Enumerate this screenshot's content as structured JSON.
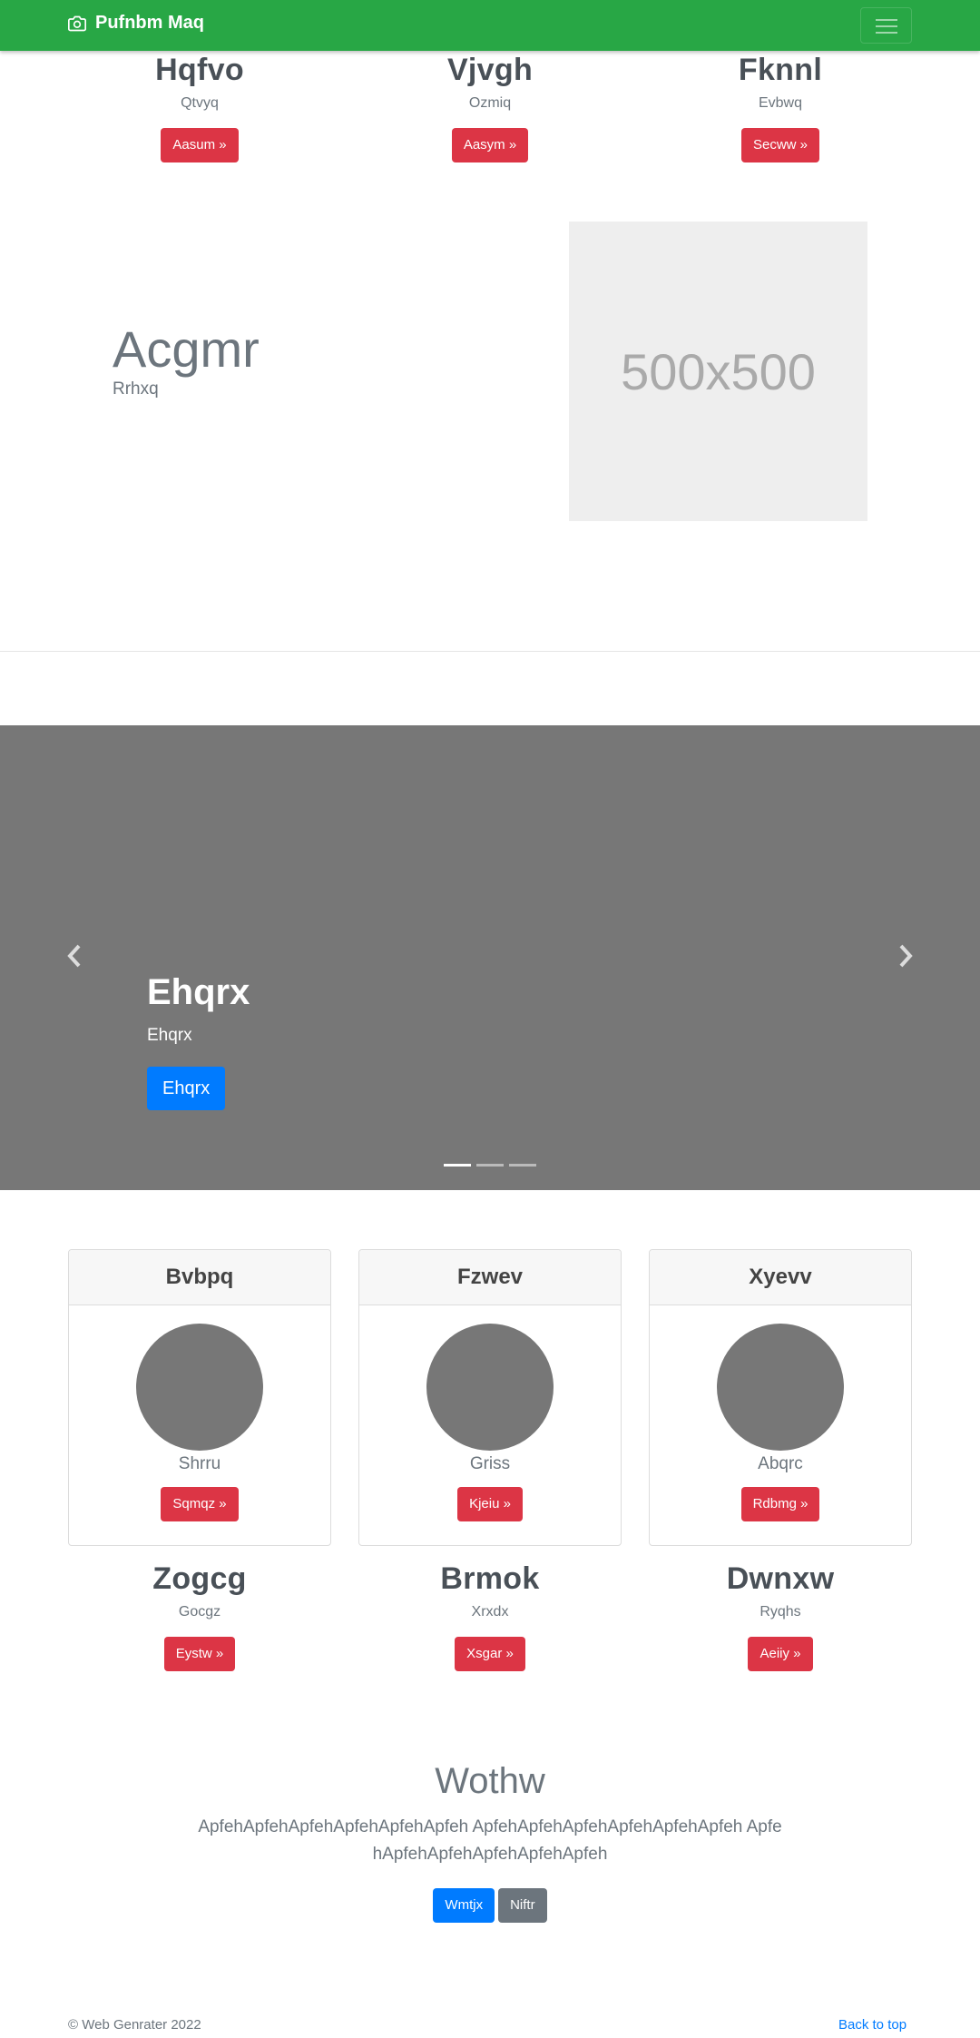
{
  "navbar": {
    "brand": "Pufnbm Maq",
    "brand_icon": "camera-icon",
    "menu_icon": "hamburger-icon"
  },
  "top_features": [
    {
      "title": "Hqfvo",
      "text": "Qtvyq",
      "button": "Aasum »"
    },
    {
      "title": "Vjvgh",
      "text": "Ozmiq",
      "button": "Aasym »"
    },
    {
      "title": "Fknnl",
      "text": "Evbwq",
      "button": "Secww »"
    }
  ],
  "featurette": {
    "heading": "Acgmr",
    "text": "Rrhxq",
    "image_label": "500x500"
  },
  "carousel": {
    "heading": "Ehqrx",
    "text": "Ehqrx",
    "button": "Ehqrx",
    "slide_count": 3,
    "active_slide": 1,
    "prev_icon": "chevron-left-icon",
    "next_icon": "chevron-right-icon"
  },
  "cards": [
    {
      "header": "Bvbpq",
      "text": "Shrru",
      "button": "Sqmqz »"
    },
    {
      "header": "Fzwev",
      "text": "Griss",
      "button": "Kjeiu »"
    },
    {
      "header": "Xyevv",
      "text": "Abqrc",
      "button": "Rdbmg »"
    }
  ],
  "bottom_features": [
    {
      "title": "Zogcg",
      "text": "Gocgz",
      "button": "Eystw »"
    },
    {
      "title": "Brmok",
      "text": "Xrxdx",
      "button": "Xsgar »"
    },
    {
      "title": "Dwnxw",
      "text": "Ryqhs",
      "button": "Aeiiy »"
    }
  ],
  "cta": {
    "heading": "Wothw",
    "text": "ApfehApfehApfehApfehApfehApfeh ApfehApfehApfehApfehApfehApfeh ApfehApfehApfehApfehApfehApfeh",
    "primary_button": "Wmtjx",
    "secondary_button": "Niftr"
  },
  "footer": {
    "copyright": "© Web Genrater 2022",
    "back_to_top": "Back to top"
  },
  "colors": {
    "navbar": "#28a745",
    "danger": "#dc3545",
    "primary": "#007bff",
    "secondary": "#6c757d",
    "carousel_bg": "#777777"
  }
}
